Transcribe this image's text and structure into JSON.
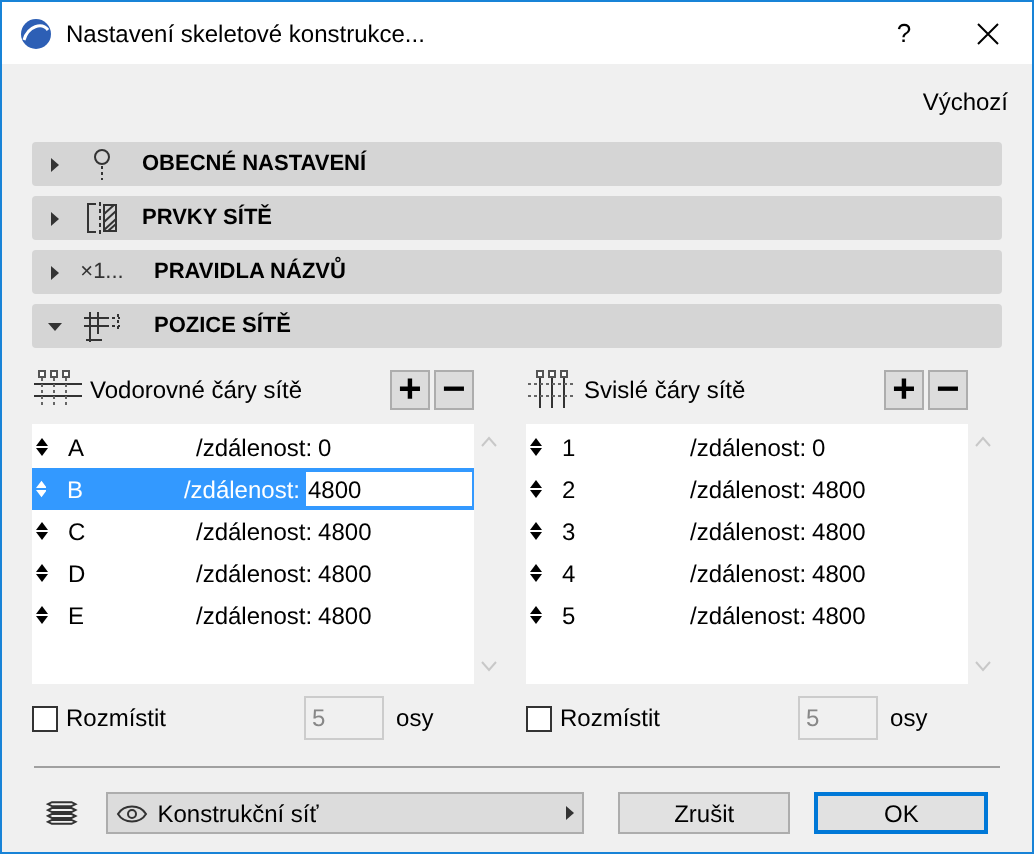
{
  "window": {
    "title": "Nastavení skeletové konstrukce...",
    "help": "?"
  },
  "default_link": "Výchozí",
  "sections": [
    {
      "label": "OBECNÉ NASTAVENÍ",
      "expanded": false,
      "kind": "pin"
    },
    {
      "label": "PRVKY SÍTĚ",
      "expanded": false,
      "kind": "elements"
    },
    {
      "label": "PRAVIDLA NÁZVŮ",
      "expanded": false,
      "kind": "naming",
      "icon_text": "×1..."
    },
    {
      "label": "POZICE SÍTĚ",
      "expanded": true,
      "kind": "grid"
    }
  ],
  "lists": [
    {
      "title": "Vodorovné čáry sítě",
      "kind": "horizontal",
      "add": "+",
      "remove": "−",
      "rows": [
        {
          "name": "A",
          "label": "/zdálenost:",
          "value": "0",
          "selected": false
        },
        {
          "name": "B",
          "label": "/zdálenost:",
          "value": "4800",
          "selected": true
        },
        {
          "name": "C",
          "label": "/zdálenost:",
          "value": "4800",
          "selected": false
        },
        {
          "name": "D",
          "label": "/zdálenost:",
          "value": "4800",
          "selected": false
        },
        {
          "name": "E",
          "label": "/zdálenost:",
          "value": "4800",
          "selected": false
        }
      ],
      "distribute": {
        "label": "Rozmístit",
        "checked": false,
        "count": "5",
        "unit": "osy"
      }
    },
    {
      "title": "Svislé čáry sítě",
      "kind": "vertical",
      "add": "+",
      "remove": "−",
      "rows": [
        {
          "name": "1",
          "label": "/zdálenost:",
          "value": "0",
          "selected": false
        },
        {
          "name": "2",
          "label": "/zdálenost:",
          "value": "4800",
          "selected": false
        },
        {
          "name": "3",
          "label": "/zdálenost:",
          "value": "4800",
          "selected": false
        },
        {
          "name": "4",
          "label": "/zdálenost:",
          "value": "4800",
          "selected": false
        },
        {
          "name": "5",
          "label": "/zdálenost:",
          "value": "4800",
          "selected": false
        }
      ],
      "distribute": {
        "label": "Rozmístit",
        "checked": false,
        "count": "5",
        "unit": "osy"
      }
    }
  ],
  "footer": {
    "layer": "Konstrukční síť",
    "cancel": "Zrušit",
    "ok": "OK"
  }
}
